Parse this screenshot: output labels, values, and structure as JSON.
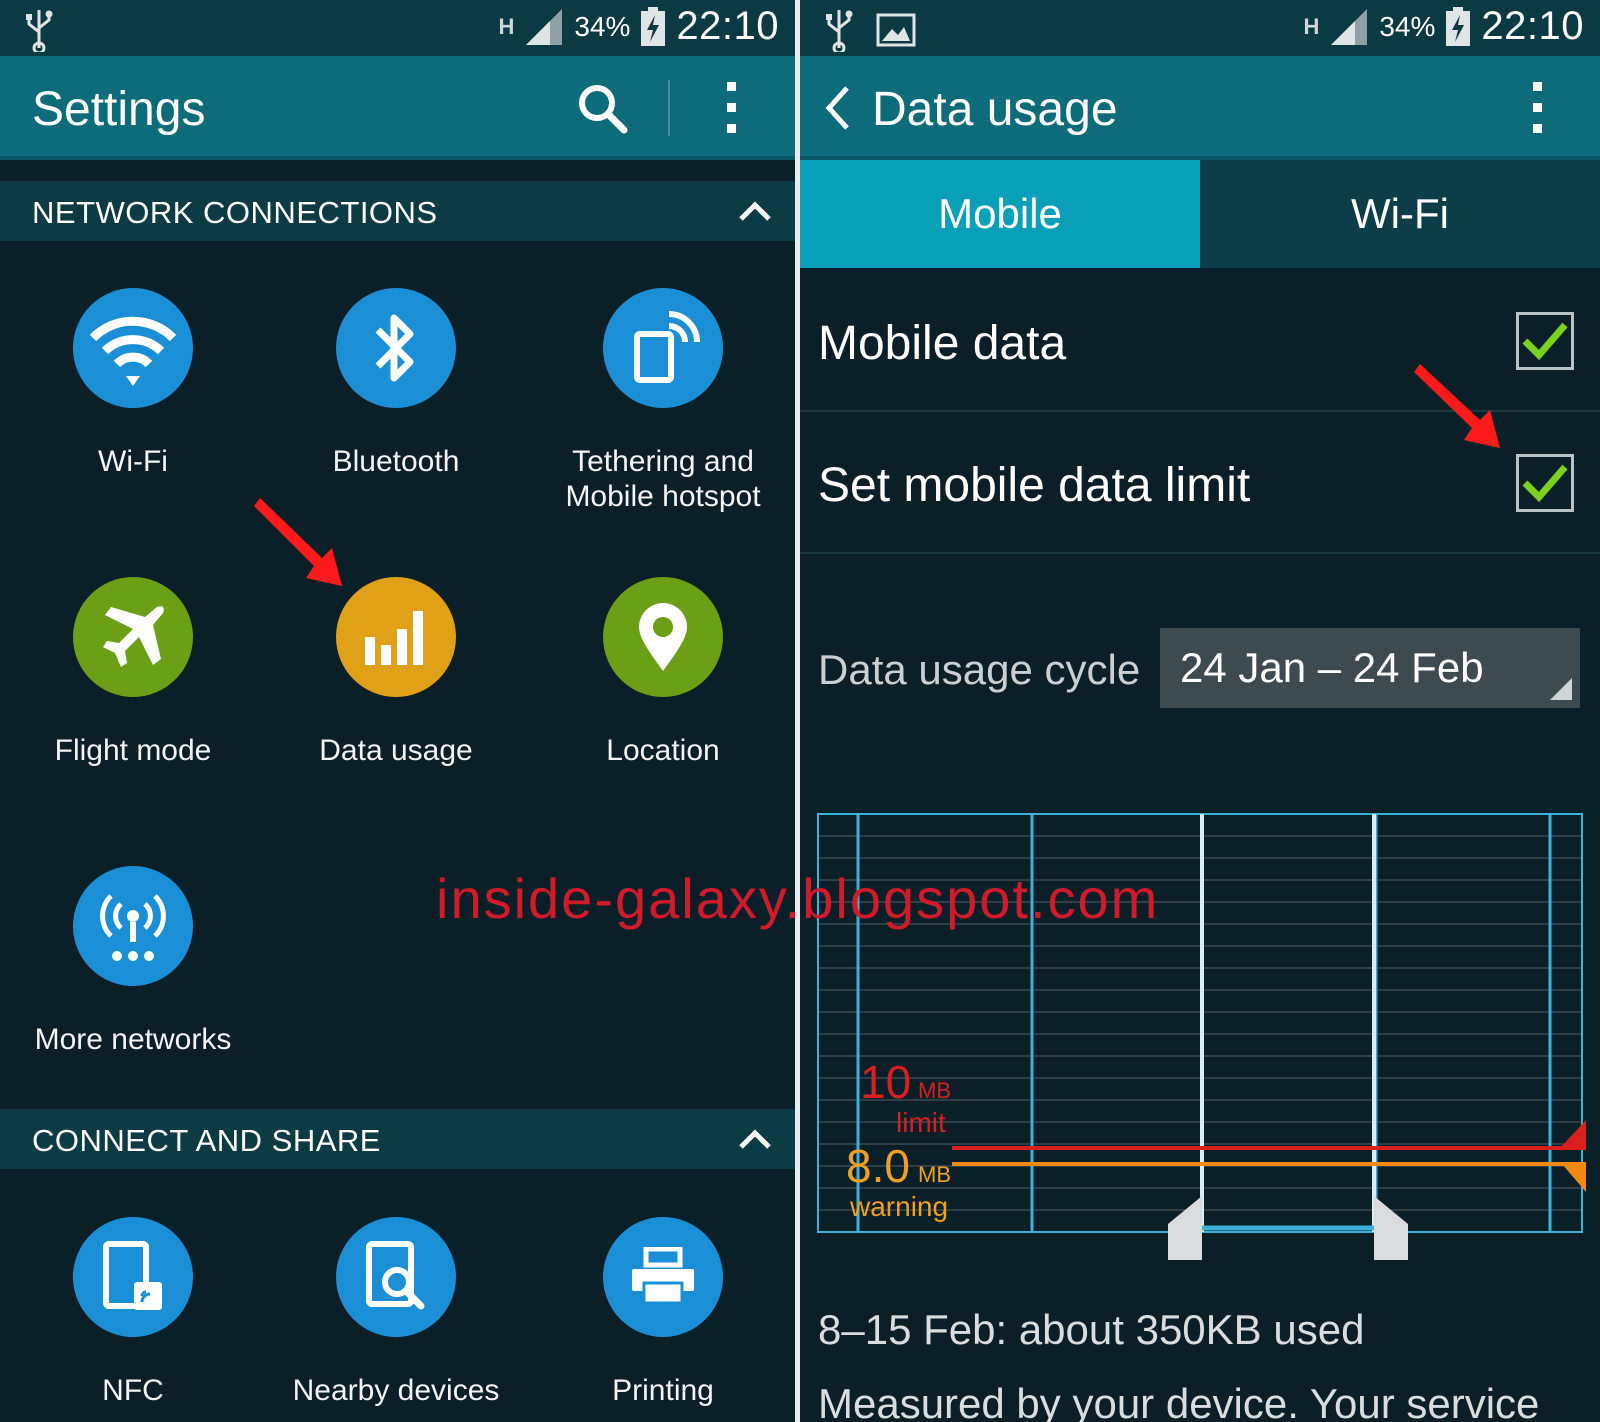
{
  "status_bar": {
    "network_type": "H",
    "battery_percent": "34%",
    "time": "22:10"
  },
  "left_screen": {
    "title": "Settings",
    "sections": [
      {
        "label": "NETWORK CONNECTIONS",
        "tiles": [
          {
            "label": "Wi-Fi",
            "icon": "wifi-icon",
            "color": "#1b8fd6"
          },
          {
            "label": "Bluetooth",
            "icon": "bluetooth-icon",
            "color": "#1b8fd6"
          },
          {
            "label": "Tethering and Mobile hotspot",
            "label_line1": "Tethering and",
            "label_line2": "Mobile hotspot",
            "icon": "tethering-icon",
            "color": "#1b8fd6"
          },
          {
            "label": "Flight mode",
            "icon": "airplane-icon",
            "color": "#6a9f16"
          },
          {
            "label": "Data usage",
            "icon": "data-usage-icon",
            "color": "#e0a017"
          },
          {
            "label": "Location",
            "icon": "location-pin-icon",
            "color": "#6a9f16"
          },
          {
            "label": "More networks",
            "icon": "more-networks-icon",
            "color": "#1b8fd6"
          }
        ]
      },
      {
        "label": "CONNECT AND SHARE",
        "tiles": [
          {
            "label": "NFC",
            "icon": "nfc-icon",
            "color": "#1b8fd6"
          },
          {
            "label": "Nearby devices",
            "icon": "nearby-devices-icon",
            "color": "#1b8fd6"
          },
          {
            "label": "Printing",
            "icon": "printer-icon",
            "color": "#1b8fd6"
          }
        ]
      }
    ]
  },
  "watermark": "inside-galaxy.blogspot.com",
  "right_screen": {
    "title": "Data usage",
    "tabs": [
      {
        "label": "Mobile",
        "active": true
      },
      {
        "label": "Wi-Fi",
        "active": false
      }
    ],
    "mobile_data": {
      "label": "Mobile data",
      "checked": true
    },
    "data_limit": {
      "label": "Set mobile data limit",
      "checked": true
    },
    "cycle": {
      "label": "Data usage cycle",
      "value": "24 Jan – 24 Feb"
    },
    "chart": {
      "limit_value": "10",
      "limit_unit": "MB",
      "limit_label": "limit",
      "warning_value": "8.0",
      "warning_unit": "MB",
      "warning_label": "warning",
      "limit_color": "#d9201f",
      "warning_color": "#f08a12",
      "grid_color": "#3fb0d8"
    },
    "usage_summary": "8–15 Feb: about 350KB used",
    "note": "Measured by your device. Your service"
  }
}
